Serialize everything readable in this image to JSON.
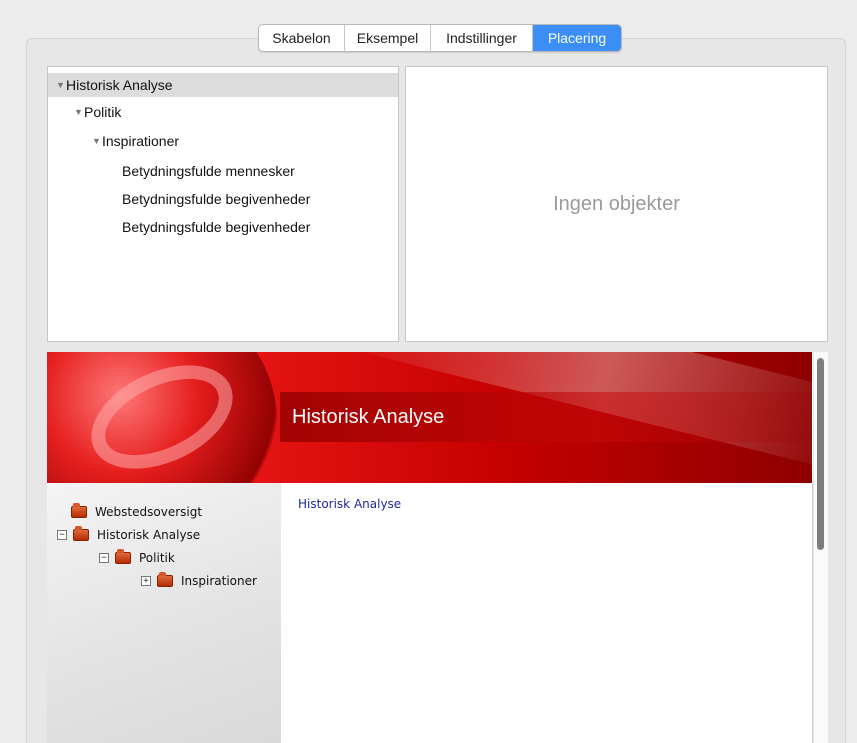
{
  "tabs": [
    "Skabelon",
    "Eksempel",
    "Indstillinger",
    "Placering"
  ],
  "active_tab": "Placering",
  "outline": [
    {
      "label": "Historisk Analyse",
      "level": 0,
      "disclosure": "▼",
      "selected": true
    },
    {
      "label": "Politik",
      "level": 1,
      "disclosure": "▼"
    },
    {
      "label": "Inspirationer",
      "level": 2,
      "disclosure": "▼"
    },
    {
      "label": "Betydningsfulde mennesker",
      "level": 3
    },
    {
      "label": "Betydningsfulde begivenheder",
      "level": 3
    },
    {
      "label": "Betydningsfulde begivenheder",
      "level": 3
    }
  ],
  "empty_panel_text": "Ingen objekter",
  "preview": {
    "banner_title": "Historisk Analyse",
    "sidebar": [
      {
        "label": "Webstedsoversigt",
        "toggle": ""
      },
      {
        "label": "Historisk Analyse",
        "toggle": "−"
      },
      {
        "label": "Politik",
        "toggle": "−"
      },
      {
        "label": "Inspirationer",
        "toggle": "+"
      }
    ],
    "content_link": "Historisk Analyse"
  },
  "colors": {
    "accent": "#3a8ef5",
    "banner_red": "#d40000",
    "link_blue": "#1a2a9a"
  }
}
